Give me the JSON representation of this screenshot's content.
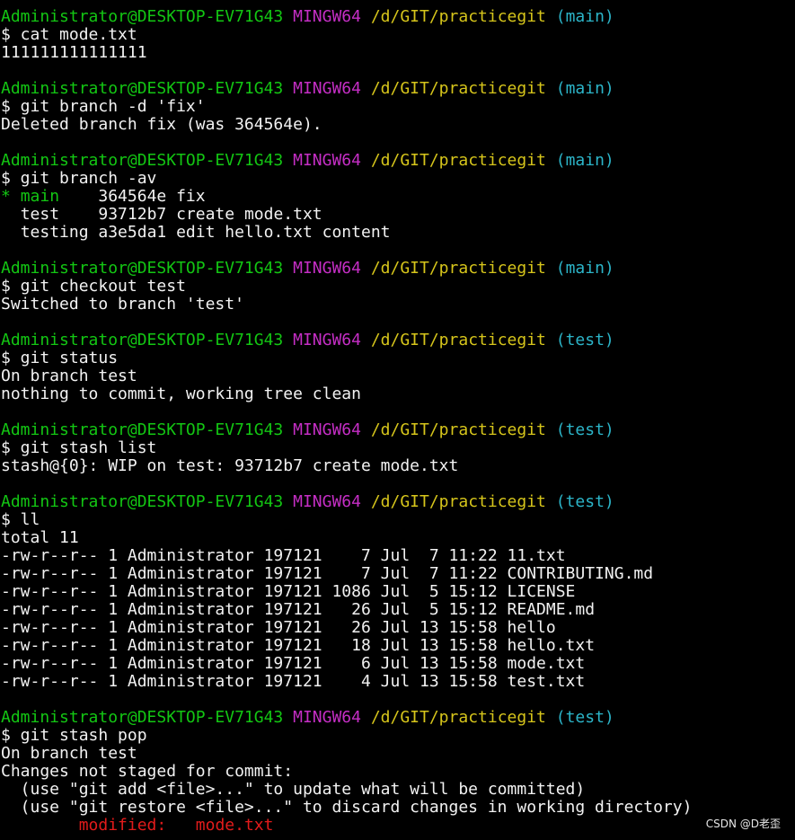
{
  "blocks": [
    {
      "prompt": {
        "user": "Administrator@DESKTOP-EV71G43",
        "system": "MINGW64",
        "path": "/d/GIT/practicegit",
        "branch": "(main)"
      },
      "command": "$ cat mode.txt",
      "output": [
        "111111111111111"
      ]
    },
    {
      "prompt": {
        "user": "Administrator@DESKTOP-EV71G43",
        "system": "MINGW64",
        "path": "/d/GIT/practicegit",
        "branch": "(main)"
      },
      "command": "$ git branch -d 'fix'",
      "output": [
        "Deleted branch fix (was 364564e)."
      ]
    },
    {
      "prompt": {
        "user": "Administrator@DESKTOP-EV71G43",
        "system": "MINGW64",
        "path": "/d/GIT/practicegit",
        "branch": "(main)"
      },
      "command": "$ git branch -av",
      "branch_list": [
        {
          "marker": "* ",
          "name": "main   ",
          "rest": " 364564e fix",
          "current": true
        },
        {
          "marker": "  ",
          "name": "test   ",
          "rest": " 93712b7 create mode.txt",
          "current": false
        },
        {
          "marker": "  ",
          "name": "testing",
          "rest": " a3e5da1 edit hello.txt content",
          "current": false
        }
      ]
    },
    {
      "prompt": {
        "user": "Administrator@DESKTOP-EV71G43",
        "system": "MINGW64",
        "path": "/d/GIT/practicegit",
        "branch": "(main)"
      },
      "command": "$ git checkout test",
      "output": [
        "Switched to branch 'test'"
      ]
    },
    {
      "prompt": {
        "user": "Administrator@DESKTOP-EV71G43",
        "system": "MINGW64",
        "path": "/d/GIT/practicegit",
        "branch": "(test)"
      },
      "command": "$ git status",
      "output": [
        "On branch test",
        "nothing to commit, working tree clean"
      ]
    },
    {
      "prompt": {
        "user": "Administrator@DESKTOP-EV71G43",
        "system": "MINGW64",
        "path": "/d/GIT/practicegit",
        "branch": "(test)"
      },
      "command": "$ git stash list",
      "output": [
        "stash@{0}: WIP on test: 93712b7 create mode.txt"
      ]
    },
    {
      "prompt": {
        "user": "Administrator@DESKTOP-EV71G43",
        "system": "MINGW64",
        "path": "/d/GIT/practicegit",
        "branch": "(test)"
      },
      "command": "$ ll",
      "output": [
        "total 11",
        "-rw-r--r-- 1 Administrator 197121    7 Jul  7 11:22 11.txt",
        "-rw-r--r-- 1 Administrator 197121    7 Jul  7 11:22 CONTRIBUTING.md",
        "-rw-r--r-- 1 Administrator 197121 1086 Jul  5 15:12 LICENSE",
        "-rw-r--r-- 1 Administrator 197121   26 Jul  5 15:12 README.md",
        "-rw-r--r-- 1 Administrator 197121   26 Jul 13 15:58 hello",
        "-rw-r--r-- 1 Administrator 197121   18 Jul 13 15:58 hello.txt",
        "-rw-r--r-- 1 Administrator 197121    6 Jul 13 15:58 mode.txt",
        "-rw-r--r-- 1 Administrator 197121    4 Jul 13 15:58 test.txt"
      ]
    },
    {
      "prompt": {
        "user": "Administrator@DESKTOP-EV71G43",
        "system": "MINGW64",
        "path": "/d/GIT/practicegit",
        "branch": "(test)"
      },
      "command": "$ git stash pop",
      "output": [
        "On branch test",
        "Changes not staged for commit:",
        "  (use \"git add <file>...\" to update what will be committed)",
        "  (use \"git restore <file>...\" to discard changes in working directory)"
      ],
      "modified": {
        "indent": "        ",
        "label": "modified:",
        "gap": "   ",
        "file": "mode.txt"
      }
    }
  ],
  "watermark": "CSDN @D老歪",
  "colors": {
    "background": "#000000",
    "text": "#f2f2f2",
    "user": "#13c613",
    "system": "#c52ec5",
    "path": "#d6c51b",
    "branch": "#2cb5c9",
    "modified": "#e21b1b"
  }
}
